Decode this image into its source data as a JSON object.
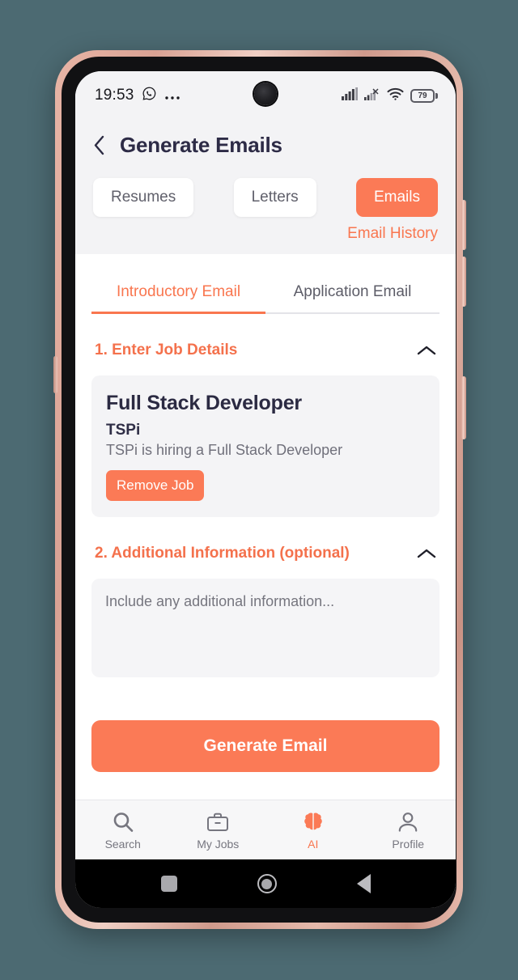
{
  "theme": {
    "accent": "#FB7A56",
    "accent_text": "#F9764F",
    "title_color": "#2D2B46",
    "background": "#4C6A72"
  },
  "status_bar": {
    "time": "19:53",
    "icons": [
      "whatsapp-icon",
      "overflow-dots-icon"
    ],
    "signal_icon": "signal-bars-icon",
    "sim2_icon": "signal-no-service-icon",
    "wifi_icon": "wifi-icon",
    "battery_level": "79"
  },
  "header": {
    "back_icon": "chevron-left-icon",
    "title": "Generate Emails"
  },
  "segments": {
    "items": [
      {
        "label": "Resumes",
        "active": false
      },
      {
        "label": "Letters",
        "active": false
      },
      {
        "label": "Emails",
        "active": true
      }
    ],
    "history_link": "Email History"
  },
  "tabs": [
    {
      "label": "Introductory Email",
      "active": true
    },
    {
      "label": "Application Email",
      "active": false
    }
  ],
  "sections": {
    "job_details": {
      "title": "1. Enter Job Details",
      "collapse_icon": "chevron-up-icon",
      "card": {
        "job_title": "Full Stack Developer",
        "company": "TSPi",
        "description": "TSPi is hiring a Full Stack Developer",
        "remove_label": "Remove Job"
      }
    },
    "additional_info": {
      "title": "2. Additional Information (optional)",
      "collapse_icon": "chevron-up-icon",
      "placeholder": "Include any additional information...",
      "value": ""
    }
  },
  "primary_action": {
    "label": "Generate Email"
  },
  "bottom_nav": [
    {
      "label": "Search",
      "icon": "search-icon",
      "active": false
    },
    {
      "label": "My Jobs",
      "icon": "briefcase-icon",
      "active": false
    },
    {
      "label": "AI",
      "icon": "brain-icon",
      "active": true
    },
    {
      "label": "Profile",
      "icon": "person-icon",
      "active": false
    }
  ],
  "system_nav": {
    "recents": "recents-square-icon",
    "home": "home-circle-icon",
    "back": "back-triangle-icon"
  }
}
